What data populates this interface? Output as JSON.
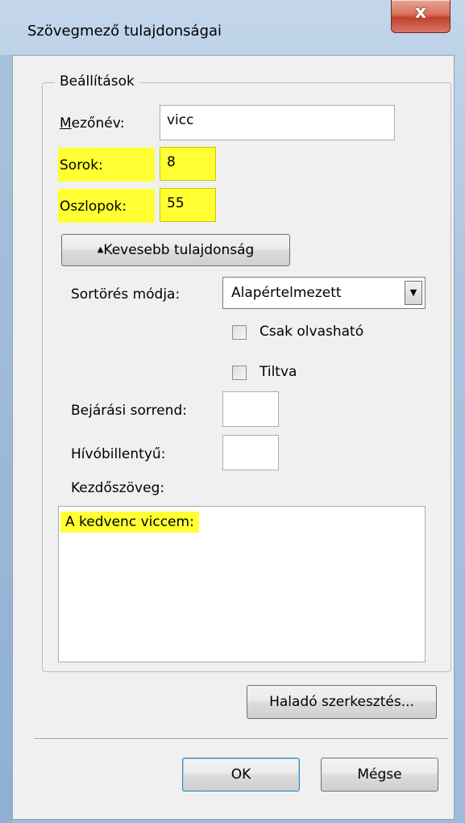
{
  "window": {
    "title": "Szövegmező tulajdonságai",
    "close_glyph": "x"
  },
  "group": {
    "legend": "Beállítások"
  },
  "fields": {
    "name_label": "Mezőnév:",
    "name_value": "vicc",
    "rows_label": "Sorok:",
    "rows_value": "8",
    "cols_label": "Oszlopok:",
    "cols_value": "55"
  },
  "less_props_button": "Kevesebb tulajdonság",
  "wrap": {
    "label": "Sortörés módja:",
    "selected": "Alapértelmezett"
  },
  "checkboxes": {
    "readonly": "Csak olvasható",
    "disabled": "Tiltva"
  },
  "tab_order": {
    "label": "Bejárási sorrend:",
    "value": ""
  },
  "access_key": {
    "label": "Hívóbillentyű:",
    "value": ""
  },
  "initial_text": {
    "label": "Kezdőszöveg:",
    "value": "A kedvenc viccem:"
  },
  "buttons": {
    "advanced": "Haladó szerkesztés...",
    "ok": "OK",
    "cancel": "Mégse"
  },
  "colors": {
    "highlight": "#ffff33",
    "title_bar": "#aac3df",
    "close_button": "#c0432c"
  }
}
